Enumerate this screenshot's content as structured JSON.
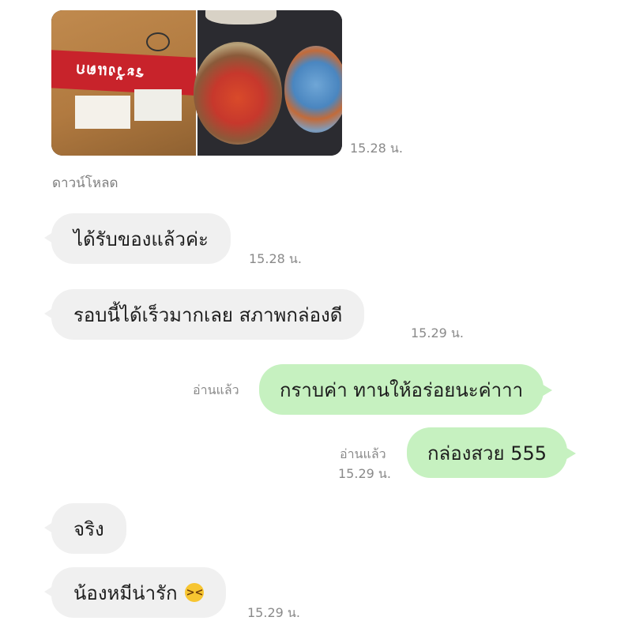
{
  "photo_message": {
    "time": "15.28 น.",
    "box_tape_text": "ระวังแตก"
  },
  "download_label": "ดาวน์โหลด",
  "messages": [
    {
      "text": "ได้รับของแล้วค่ะ",
      "time": "15.28 น."
    },
    {
      "text": "รอบนี้ได้เร็วมากเลย สภาพกล่องดี",
      "time": "15.29 น."
    },
    {
      "text": "กราบค่า ทานให้อร่อยนะค่าาา",
      "read": "อ่านแล้ว"
    },
    {
      "text": "กล่องสวย 555",
      "read": "อ่านแล้ว",
      "time": "15.29 น."
    },
    {
      "text": "จริง"
    },
    {
      "text": "น้องหมีน่ารัก",
      "emoji": "laughing-face-emoji",
      "time": "15.29 น."
    }
  ],
  "colors": {
    "incoming_bubble": "#f0f0f0",
    "outgoing_bubble": "#c6f1c0",
    "meta_text": "#8a8a8a"
  }
}
